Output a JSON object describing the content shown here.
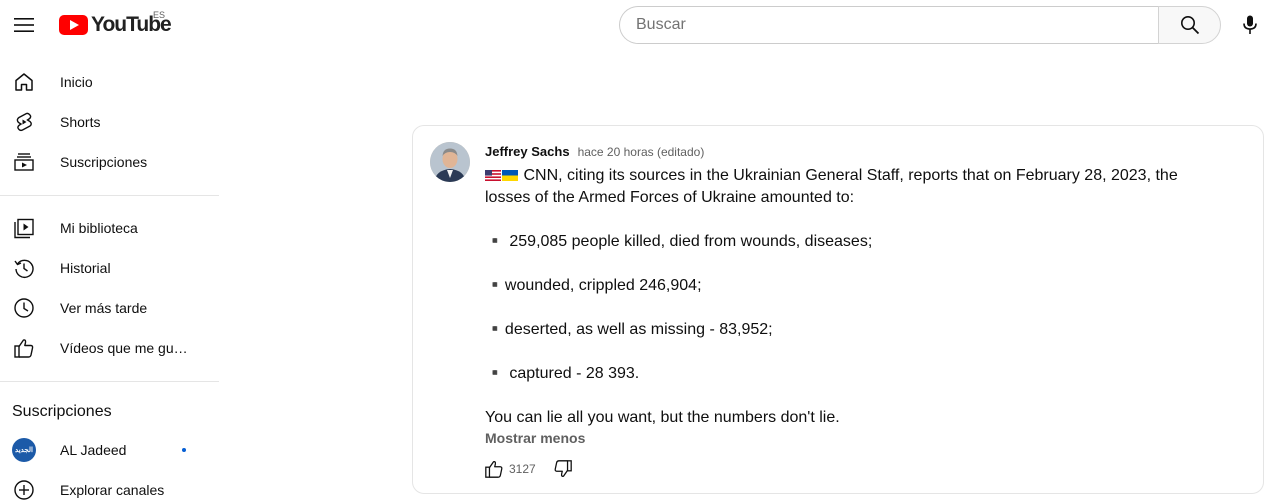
{
  "header": {
    "logo_text": "YouTube",
    "country_code": "ES",
    "search_placeholder": "Buscar"
  },
  "sidebar": {
    "main": [
      {
        "label": "Inicio",
        "icon": "home-icon"
      },
      {
        "label": "Shorts",
        "icon": "shorts-icon"
      },
      {
        "label": "Suscripciones",
        "icon": "subscriptions-icon"
      }
    ],
    "library": [
      {
        "label": "Mi biblioteca",
        "icon": "library-icon"
      },
      {
        "label": "Historial",
        "icon": "history-icon"
      },
      {
        "label": "Ver más tarde",
        "icon": "watch-later-icon"
      },
      {
        "label": "Vídeos que me gustan",
        "icon": "like-icon"
      }
    ],
    "subscriptions_heading": "Suscripciones",
    "channels": [
      {
        "label": "AL Jadeed",
        "avatar_text": "الجديد",
        "live": true
      },
      {
        "label": "Explorar canales",
        "icon": "add-circle-icon"
      }
    ]
  },
  "comment": {
    "author": "Jeffrey Sachs",
    "time": "hace 20 horas (editado)",
    "flags": [
      "us-flag",
      "ukraine-flag"
    ],
    "lines": [
      "CNN, citing its sources in the Ukrainian General Staff, reports that on February 28, 2023, the",
      "losses of the Armed Forces of Ukraine amounted to:",
      "",
      "▪️ 259,085 people killed, died from wounds, diseases;",
      "",
      "▪️wounded, crippled 246,904;",
      "",
      "▪️deserted, as well as missing - 83,952;",
      "",
      "▪️ captured - 28 393.",
      "",
      "You can lie all you want, but the numbers don't lie."
    ],
    "show_less": "Mostrar menos",
    "likes": "3127"
  },
  "colors": {
    "brand_red": "#ff0000",
    "link_blue": "#065fd4",
    "secondary_text": "#606060"
  }
}
